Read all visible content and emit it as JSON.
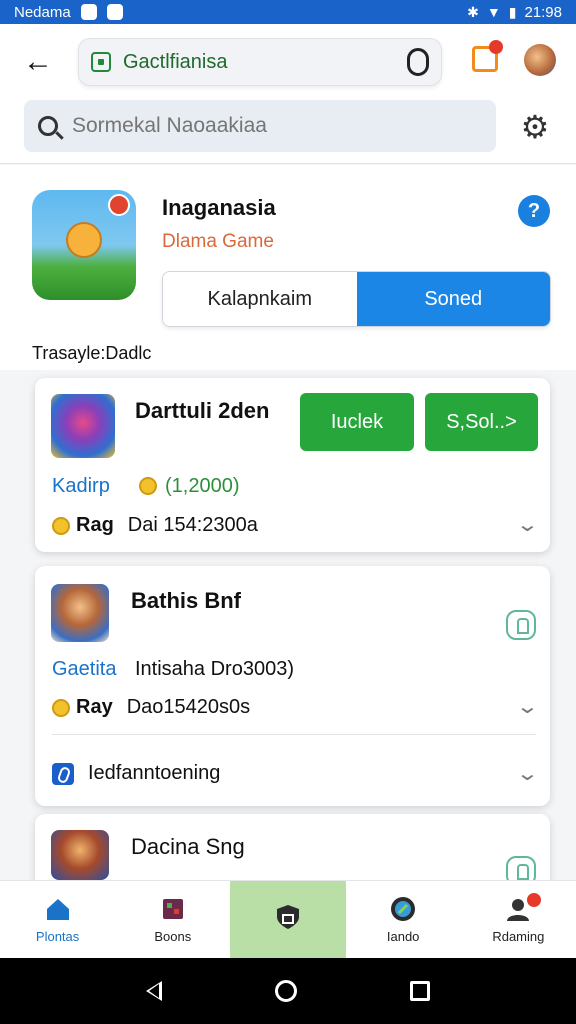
{
  "status_bar": {
    "carrier": "Nedama",
    "time": "21:98"
  },
  "header": {
    "url": "Gactlfianisa",
    "search_placeholder": "Sormekal Naoaakiaa"
  },
  "app": {
    "title": "Inaganasia",
    "subtitle": "Dlama Game",
    "segments": [
      {
        "label": "Kalapnkaim",
        "active": false
      },
      {
        "label": "Soned",
        "active": true
      }
    ],
    "section_label": "Trasayle:Dadlc"
  },
  "cards": [
    {
      "name": "Darttuli 2den",
      "kind": "Kadirp",
      "price": "(1,2000)",
      "rating_label": "Rag",
      "rating_value": "Dai 154:2300a",
      "buttons": [
        "Iuclek",
        "S,Sol..>"
      ]
    },
    {
      "name": "Bathis Bnf",
      "kind": "Gaetita",
      "price": "Intisaha Dro3003)",
      "rating_label": "Ray",
      "rating_value": "Dao15420s0s",
      "extra": "Iedfanntoening"
    },
    {
      "name": "Dacina Sng"
    }
  ],
  "bottom_nav": [
    {
      "label": "Plontas",
      "icon": "home-icon"
    },
    {
      "label": "Boons",
      "icon": "store-icon"
    },
    {
      "label": "",
      "icon": "shield-icon"
    },
    {
      "label": "Iando",
      "icon": "compass-icon"
    },
    {
      "label": "Rdaming",
      "icon": "person-icon"
    }
  ],
  "colors": {
    "status_bar": "#1a63c9",
    "accent_blue": "#1b86e6",
    "button_green": "#27a63c",
    "nav_active": "#b9dfa7"
  }
}
